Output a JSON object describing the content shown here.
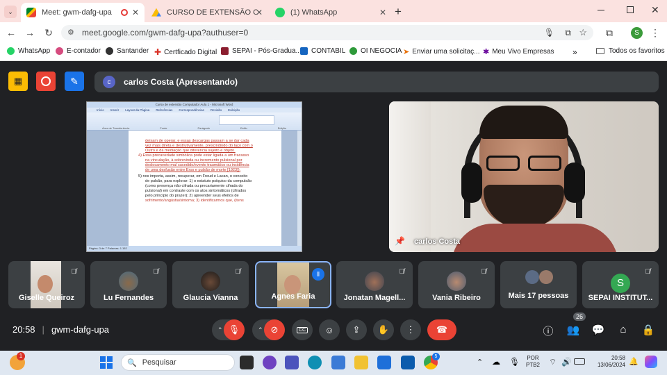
{
  "browser": {
    "tabs": [
      {
        "label": "Meet: gwm-dafg-upa",
        "active": true
      },
      {
        "label": "CURSO DE EXTENSÃO COMPU",
        "active": false
      },
      {
        "label": "(1) WhatsApp",
        "active": false
      }
    ],
    "url": "meet.google.com/gwm-dafg-upa?authuser=0",
    "profile_initial": "S",
    "bookmarks": [
      "WhatsApp",
      "E-contador",
      "Santander",
      "Certficado Digital",
      "SEPAI - Pós-Gradua...",
      "CONTABIL",
      "OI NEGOCIA",
      "Enviar uma solicitaç...",
      "Meu Vivo Empresas"
    ],
    "more_bookmarks": "»",
    "all_favorites": "Todos os favoritos"
  },
  "meet": {
    "presenter_initial": "c",
    "presenter_banner": "carlos Costa (Apresentando)",
    "camera_label": "carlos Costa",
    "participants": [
      {
        "name": "Giselle Queiroz"
      },
      {
        "name": "Lu Fernandes"
      },
      {
        "name": "Glaucia Vianna"
      },
      {
        "name": "Agnes Faria"
      },
      {
        "name": "Jonatan Magell..."
      },
      {
        "name": "Vania Ribeiro"
      },
      {
        "name": "Mais 17 pessoas"
      },
      {
        "name": "SEPAI INSTITUT...",
        "initial": "S"
      }
    ],
    "time": "20:58",
    "meeting_code": "gwm-dafg-upa",
    "people_count": "26"
  },
  "shared_doc": {
    "window_title": "Curso de extensão Computador Aula 1 - Microsoft Word",
    "ribbon_tabs": [
      "Início",
      "Inserir",
      "Layout da Página",
      "Referências",
      "Correspondências",
      "Revisão",
      "Exibição"
    ],
    "ribbon_groups": [
      "Área de Transferência",
      "Fonte",
      "Parágrafo",
      "Estilo",
      "Edição"
    ],
    "lines": [
      "deixam de operar, e essas descargas passam a se dar cada",
      "vez mais direta e destrutivamente, prescindindo do laço com o",
      "Outro e da mediação que diferencia sujeito e objeto.",
      "4)  Essa precariedade simbólica pode estar ligada a um fracasso",
      "na vinculação, à sobrevinda ou incremento pulsional por",
      "deslocamento mal sucedido/evento traumático ou incidência",
      "de uma desfusão entre Eros e pulsão de morte [1923]).",
      "5)  nos importa, assim, recuperar, em Freud e Lacan, o conceito",
      "de pulsão, para explorar: 1) o estatuto psíquico da compulsão",
      "(como presença não cifrada ou precariamente cifrada do",
      "pulsional) em contraste com os atos sintomáticos (cifrados",
      "pelo princípio do prazer); 2) apreender seus efeitos de",
      "sofrimento/angústia/sintoma; 3) identificarmos que, (itens"
    ],
    "status": "Página: 3 de 7    Palavras: 1.152"
  },
  "taskbar": {
    "search_placeholder": "Pesquisar",
    "notification_badge": "1",
    "language": "POR",
    "keyboard": "PTB2",
    "time": "20:58",
    "date": "13/06/2024",
    "chrome_badge": "5"
  },
  "colors": {
    "end_call": "#ea4335",
    "accent_blue": "#8ab4f8",
    "tab_bar": "#fbe2e0",
    "meet_bg": "#202124"
  }
}
